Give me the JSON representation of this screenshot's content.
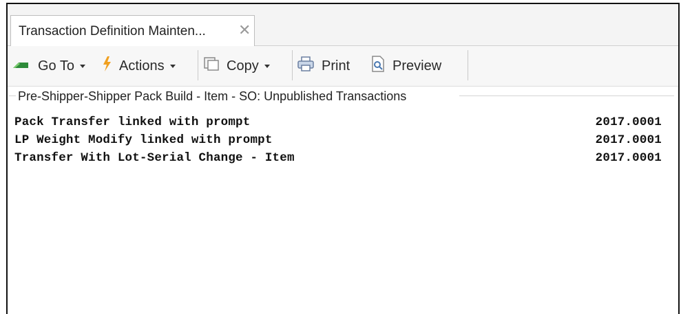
{
  "tab": {
    "title": "Transaction Definition Mainten...",
    "close_glyph": "✕"
  },
  "toolbar": {
    "goto_label": "Go To",
    "actions_label": "Actions",
    "copy_label": "Copy",
    "print_label": "Print",
    "preview_label": "Preview"
  },
  "group": {
    "title": "Pre-Shipper-Shipper Pack Build - Item - SO: Unpublished Transactions"
  },
  "transactions": [
    {
      "name": "Pack Transfer linked with prompt",
      "version": "2017.0001"
    },
    {
      "name": "LP Weight Modify linked with prompt",
      "version": "2017.0001"
    },
    {
      "name": "Transfer With Lot-Serial Change - Item",
      "version": "2017.0001"
    }
  ],
  "colors": {
    "goto_icon": "#2e8b3a",
    "actions_icon": "#f0a020",
    "frame": "#111111"
  }
}
